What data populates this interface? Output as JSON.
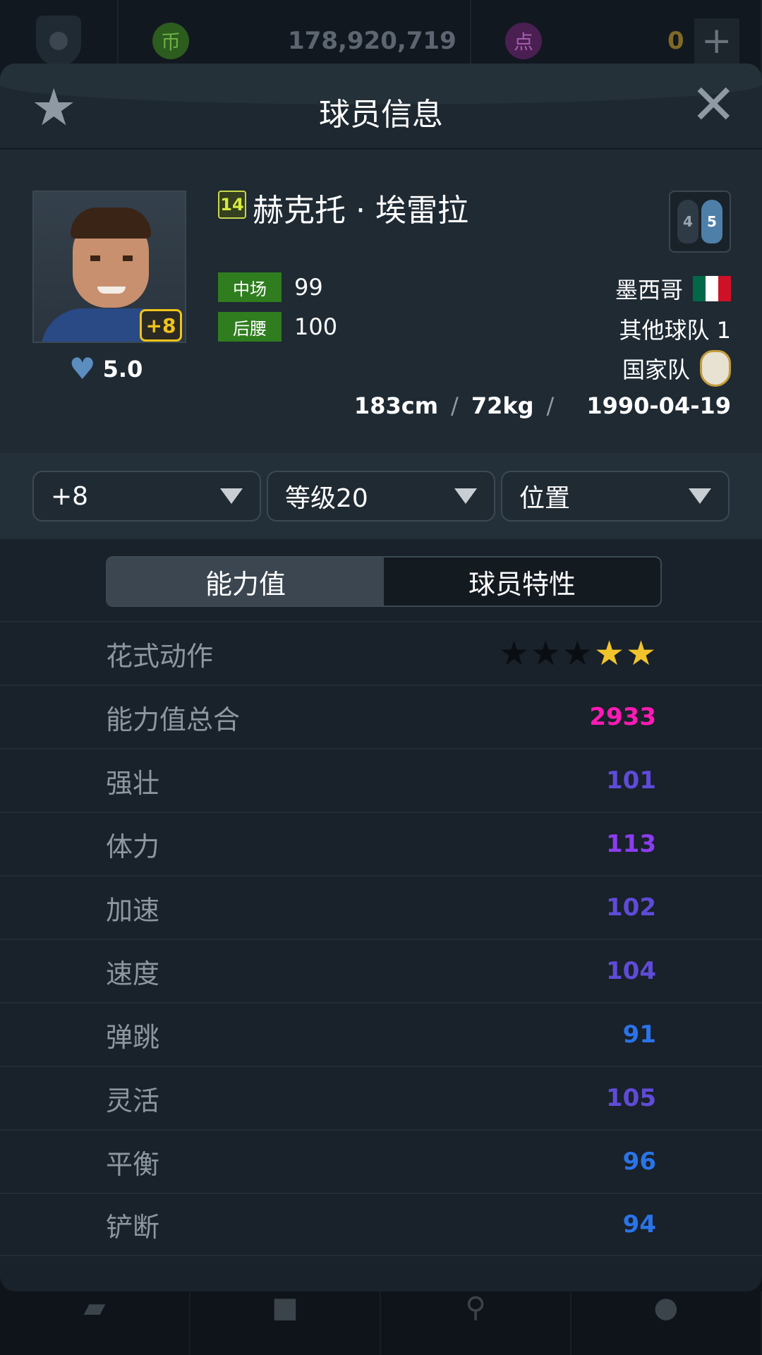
{
  "topbar": {
    "coin_icon": "币",
    "coin_value": "178,920,719",
    "point_icon": "点",
    "point_value": "0",
    "plus_icon": "+"
  },
  "modal": {
    "title": "球员信息",
    "star_icon": "★",
    "close_icon": "✕"
  },
  "player": {
    "season_badge": "14",
    "name": "赫克托 · 埃雷拉",
    "upgrade_badge": "+8",
    "likes": "5.0",
    "heart_icon": "♥",
    "weak_foot": "4",
    "strong_foot": "5",
    "positions": [
      {
        "pos": "中场",
        "ovr": "99"
      },
      {
        "pos": "后腰",
        "ovr": "100"
      }
    ],
    "nationality": "墨西哥",
    "club": "其他球队 1",
    "national_team": "国家队",
    "height": "183cm",
    "weight": "72kg",
    "birthdate": "1990-04-19",
    "flag_colors": [
      "#006847",
      "#ffffff",
      "#ce1126"
    ]
  },
  "filters": [
    {
      "label": "+8"
    },
    {
      "label": "等级20"
    },
    {
      "label": "位置"
    }
  ],
  "tabs": [
    {
      "label": "能力值",
      "active": true
    },
    {
      "label": "球员特性",
      "active": false
    }
  ],
  "skill_moves": {
    "label": "花式动作",
    "stars_total": 5,
    "stars_filled": 2
  },
  "attributes": [
    {
      "label": "能力值总合",
      "value": "2933",
      "color": "#ff1ab5"
    },
    {
      "label": "强壮",
      "value": "101",
      "color": "#5f4bd8"
    },
    {
      "label": "体力",
      "value": "113",
      "color": "#8a3df0"
    },
    {
      "label": "加速",
      "value": "102",
      "color": "#5f4bd8"
    },
    {
      "label": "速度",
      "value": "104",
      "color": "#5f4bd8"
    },
    {
      "label": "弹跳",
      "value": "91",
      "color": "#2a74e8"
    },
    {
      "label": "灵活",
      "value": "105",
      "color": "#5f4bd8"
    },
    {
      "label": "平衡",
      "value": "96",
      "color": "#2a74e8"
    },
    {
      "label": "铲断",
      "value": "94",
      "color": "#2a74e8"
    }
  ]
}
